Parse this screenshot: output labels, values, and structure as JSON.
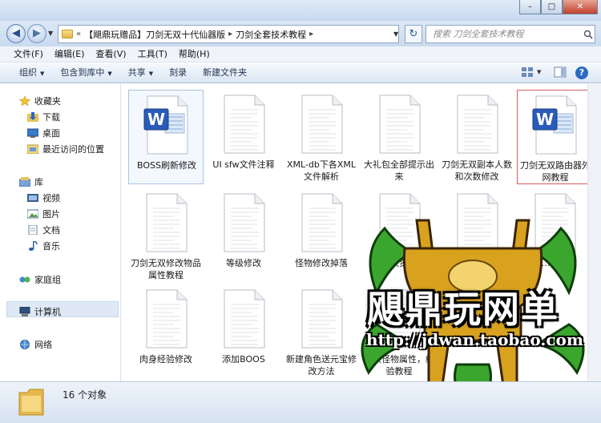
{
  "window": {
    "minimize": "–",
    "maximize": "□",
    "close": "✕"
  },
  "address": {
    "back_icon": "back-arrow",
    "forward_icon": "forward-arrow",
    "overflow": "«",
    "crumbs": [
      "【飓鼎玩赠品】刀剑无双十代仙器版",
      "刀剑全套技术教程"
    ],
    "separator": "▸",
    "search_placeholder": "搜索 刀剑全套技术教程"
  },
  "menu": [
    "文件(F)",
    "编辑(E)",
    "查看(V)",
    "工具(T)",
    "帮助(H)"
  ],
  "toolbar": {
    "organize": "组织",
    "include_library": "包含到库中",
    "share": "共享",
    "burn": "刻录",
    "new_folder": "新建文件夹"
  },
  "nav": {
    "favorites": "收藏夹",
    "downloads": "下载",
    "desktop": "桌面",
    "recent": "最近访问的位置",
    "libraries": "库",
    "videos": "视频",
    "pictures": "图片",
    "documents": "文档",
    "music": "音乐",
    "homegroup": "家庭组",
    "computer": "计算机",
    "network": "网络"
  },
  "files": [
    {
      "name": "BOSS刷新修改",
      "type": "word"
    },
    {
      "name": "UI sfw文件注释",
      "type": "text"
    },
    {
      "name": "XML-db下各XML文件解析",
      "type": "text"
    },
    {
      "name": "大礼包全部提示出来",
      "type": "text"
    },
    {
      "name": "刀剑无双副本人数和次数修改",
      "type": "text"
    },
    {
      "name": "刀剑无双路由器外网教程",
      "type": "word"
    },
    {
      "name": "刀剑无双修改物品属性教程",
      "type": "text"
    },
    {
      "name": "等级修改",
      "type": "text"
    },
    {
      "name": "怪物修改掉落",
      "type": "text"
    },
    {
      "name": "…改资…",
      "type": "text"
    },
    {
      "name": "",
      "type": "text"
    },
    {
      "name": "…配置",
      "type": "text"
    },
    {
      "name": "肉身经验修改",
      "type": "text"
    },
    {
      "name": "添加BOOS",
      "type": "text"
    },
    {
      "name": "新建角色送元宝修改方法",
      "type": "text"
    },
    {
      "name": "修改怪物属性，经验教程",
      "type": "text"
    }
  ],
  "status": {
    "count": "16 个对象"
  },
  "watermark": {
    "title": "飓鼎玩网单",
    "url": "http://jdwan.taobao.com"
  },
  "colors": {
    "accent": "#2d6bc4",
    "selection_border": "#d75b5b",
    "watermark_green": "#3aa62e",
    "watermark_gold": "#d8a21f"
  }
}
